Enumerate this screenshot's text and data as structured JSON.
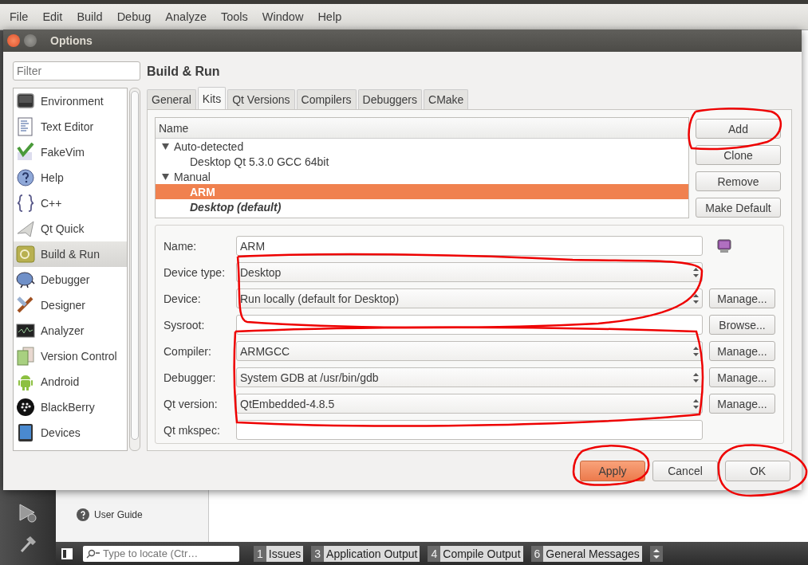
{
  "menu_bar": [
    "File",
    "Edit",
    "Build",
    "Debug",
    "Analyze",
    "Tools",
    "Window",
    "Help"
  ],
  "dialog": {
    "title": "Options",
    "filter": {
      "placeholder": "Filter"
    },
    "categories": [
      {
        "label": "Environment",
        "selected": false
      },
      {
        "label": "Text Editor",
        "selected": false
      },
      {
        "label": "FakeVim",
        "selected": false
      },
      {
        "label": "Help",
        "selected": false
      },
      {
        "label": "C++",
        "selected": false
      },
      {
        "label": "Qt Quick",
        "selected": false
      },
      {
        "label": "Build & Run",
        "selected": true
      },
      {
        "label": "Debugger",
        "selected": false
      },
      {
        "label": "Designer",
        "selected": false
      },
      {
        "label": "Analyzer",
        "selected": false
      },
      {
        "label": "Version Control",
        "selected": false
      },
      {
        "label": "Android",
        "selected": false
      },
      {
        "label": "BlackBerry",
        "selected": false
      },
      {
        "label": "Devices",
        "selected": false
      }
    ],
    "heading": "Build & Run",
    "tabs": [
      {
        "label": "General",
        "selected": false
      },
      {
        "label": "Kits",
        "selected": true
      },
      {
        "label": "Qt Versions",
        "selected": false
      },
      {
        "label": "Compilers",
        "selected": false
      },
      {
        "label": "Debuggers",
        "selected": false
      },
      {
        "label": "CMake",
        "selected": false
      }
    ],
    "kits": {
      "column": "Name",
      "groups": [
        {
          "label": "Auto-detected",
          "expanded": true,
          "children": [
            {
              "label": "Desktop Qt 5.3.0 GCC 64bit",
              "selected": false,
              "bold": false,
              "italic": false
            }
          ]
        },
        {
          "label": "Manual",
          "expanded": true,
          "children": [
            {
              "label": "ARM",
              "selected": true,
              "bold": true,
              "italic": false
            },
            {
              "label": "Desktop (default)",
              "selected": false,
              "bold": true,
              "italic": true
            }
          ]
        }
      ]
    },
    "kit_buttons": [
      "Add",
      "Clone",
      "Remove",
      "Make Default"
    ],
    "fields": [
      {
        "label": "Name:",
        "kind": "name",
        "value": "ARM"
      },
      {
        "label": "Device type:",
        "kind": "combo",
        "value": "Desktop"
      },
      {
        "label": "Device:",
        "kind": "combo",
        "value": "Run locally (default for Desktop)",
        "action": "Manage..."
      },
      {
        "label": "Sysroot:",
        "kind": "text",
        "action": "Browse..."
      },
      {
        "label": "Compiler:",
        "kind": "combo",
        "value": "ARMGCC",
        "action": "Manage..."
      },
      {
        "label": "Debugger:",
        "kind": "combo",
        "value": "System GDB at /usr/bin/gdb",
        "action": "Manage..."
      },
      {
        "label": "Qt version:",
        "kind": "combo",
        "value": "QtEmbedded-4.8.5",
        "action": "Manage..."
      },
      {
        "label": "Qt mkspec:",
        "kind": "text"
      }
    ],
    "buttons": [
      {
        "label": "Apply",
        "default": true
      },
      {
        "label": "Cancel",
        "default": false
      },
      {
        "label": "OK",
        "default": false
      }
    ]
  },
  "welcome": {
    "items": [
      "User Guide"
    ]
  },
  "status_bar": {
    "locator": {
      "placeholder": "Type to locate (Ctr…"
    },
    "panes": [
      {
        "number": "1",
        "label": "Issues"
      },
      {
        "number": "3",
        "label": "Application Output"
      },
      {
        "number": "4",
        "label": "Compile Output"
      },
      {
        "number": "6",
        "label": "General Messages"
      }
    ]
  }
}
